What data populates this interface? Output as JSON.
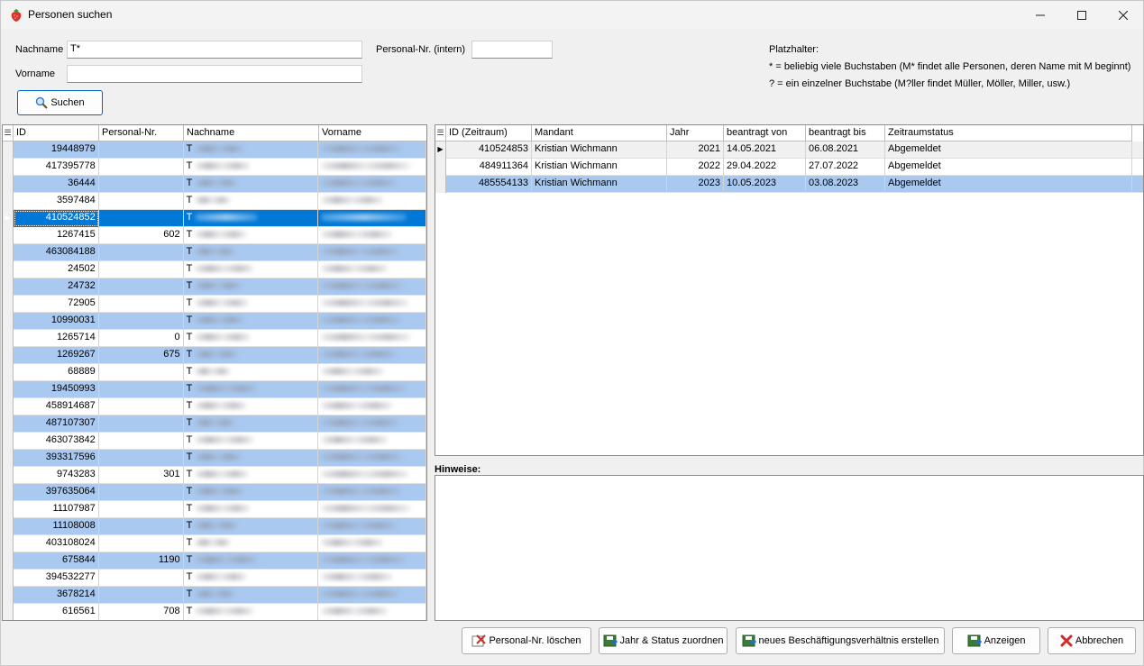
{
  "window": {
    "title": "Personen suchen",
    "app_icon": "strawberry-icon"
  },
  "search": {
    "nachname_label": "Nachname",
    "nachname_value": "T*",
    "vorname_label": "Vorname",
    "vorname_value": "",
    "personal_nr_label": "Personal-Nr. (intern)",
    "personal_nr_value": "",
    "search_button": "Suchen"
  },
  "help": {
    "title": "Platzhalter:",
    "line1": "* = beliebig viele Buchstaben (M* findet alle Personen, deren Name mit M beginnt)",
    "line2": "? = ein einzelner Buchstabe (M?ller findet Müller, Möller, Miller, usw.)"
  },
  "persons_grid": {
    "columns": [
      "ID",
      "Personal-Nr.",
      "Nachname",
      "Vorname"
    ],
    "rows": [
      {
        "id": "19448979",
        "pnr": "",
        "nach": "T",
        "vor": ""
      },
      {
        "id": "417395778",
        "pnr": "",
        "nach": "T",
        "vor": ""
      },
      {
        "id": "36444",
        "pnr": "",
        "nach": "T",
        "vor": ""
      },
      {
        "id": "3597484",
        "pnr": "",
        "nach": "T",
        "vor": ""
      },
      {
        "id": "410524852",
        "pnr": "",
        "nach": "T",
        "vor": ""
      },
      {
        "id": "1267415",
        "pnr": "602",
        "nach": "T",
        "vor": ""
      },
      {
        "id": "463084188",
        "pnr": "",
        "nach": "T",
        "vor": ""
      },
      {
        "id": "24502",
        "pnr": "",
        "nach": "T",
        "vor": ""
      },
      {
        "id": "24732",
        "pnr": "",
        "nach": "T",
        "vor": ""
      },
      {
        "id": "72905",
        "pnr": "",
        "nach": "T",
        "vor": ""
      },
      {
        "id": "10990031",
        "pnr": "",
        "nach": "T",
        "vor": ""
      },
      {
        "id": "1265714",
        "pnr": "0",
        "nach": "T",
        "vor": ""
      },
      {
        "id": "1269267",
        "pnr": "675",
        "nach": "T",
        "vor": ""
      },
      {
        "id": "68889",
        "pnr": "",
        "nach": "T",
        "vor": ""
      },
      {
        "id": "19450993",
        "pnr": "",
        "nach": "T",
        "vor": ""
      },
      {
        "id": "458914687",
        "pnr": "",
        "nach": "T",
        "vor": ""
      },
      {
        "id": "487107307",
        "pnr": "",
        "nach": "T",
        "vor": ""
      },
      {
        "id": "463073842",
        "pnr": "",
        "nach": "T",
        "vor": ""
      },
      {
        "id": "393317596",
        "pnr": "",
        "nach": "T",
        "vor": ""
      },
      {
        "id": "9743283",
        "pnr": "301",
        "nach": "T",
        "vor": ""
      },
      {
        "id": "397635064",
        "pnr": "",
        "nach": "T",
        "vor": ""
      },
      {
        "id": "11107987",
        "pnr": "",
        "nach": "T",
        "vor": ""
      },
      {
        "id": "11108008",
        "pnr": "",
        "nach": "T",
        "vor": ""
      },
      {
        "id": "403108024",
        "pnr": "",
        "nach": "T",
        "vor": ""
      },
      {
        "id": "675844",
        "pnr": "1190",
        "nach": "T",
        "vor": ""
      },
      {
        "id": "394532277",
        "pnr": "",
        "nach": "T",
        "vor": ""
      },
      {
        "id": "3678214",
        "pnr": "",
        "nach": "T",
        "vor": ""
      },
      {
        "id": "616561",
        "pnr": "708",
        "nach": "T",
        "vor": ""
      }
    ],
    "selected_index": 4
  },
  "periods_grid": {
    "columns": [
      "ID (Zeitraum)",
      "Mandant",
      "Jahr",
      "beantragt von",
      "beantragt bis",
      "Zeitraumstatus"
    ],
    "rows": [
      {
        "id": "410524853",
        "mandant": "Kristian Wichmann",
        "jahr": "2021",
        "von": "14.05.2021",
        "bis": "06.08.2021",
        "status": "Abgemeldet"
      },
      {
        "id": "484911364",
        "mandant": "Kristian Wichmann",
        "jahr": "2022",
        "von": "29.04.2022",
        "bis": "27.07.2022",
        "status": "Abgemeldet"
      },
      {
        "id": "485554133",
        "mandant": "Kristian Wichmann",
        "jahr": "2023",
        "von": "10.05.2023",
        "bis": "03.08.2023",
        "status": "Abgemeldet"
      }
    ]
  },
  "hinweise": {
    "label": "Hinweise:",
    "text": ""
  },
  "footer": {
    "delete_pnr": "Personal-Nr. löschen",
    "assign_year": "Jahr & Status zuordnen",
    "new_employment": "neues Beschäftigungsverhältnis erstellen",
    "show": "Anzeigen",
    "cancel": "Abbrechen"
  }
}
